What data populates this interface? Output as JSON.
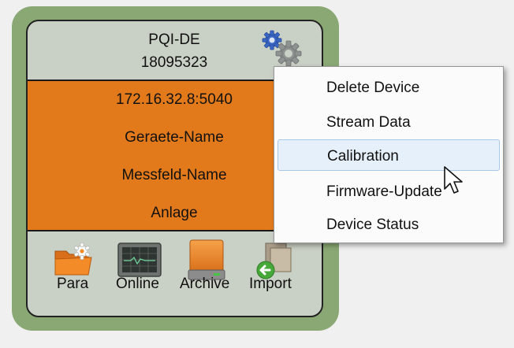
{
  "device": {
    "name": "PQI-DE",
    "serial": "18095323",
    "ip": "172.16.32.8:5040",
    "device_name": "Geraete-Name",
    "field_name": "Messfeld-Name",
    "plant": "Anlage"
  },
  "toolbar": {
    "para": "Para",
    "online": "Online",
    "archive": "Archive",
    "import": "Import"
  },
  "context_menu": {
    "items": [
      "Delete Device",
      "Stream Data",
      "Calibration",
      "Firmware-Update",
      "Device Status"
    ],
    "hovered": "Calibration"
  },
  "colors": {
    "outer_frame": "#8aa874",
    "card": "#c9d0c5",
    "info_panel": "#e27a1c",
    "menu_hover": "#e6f0fa"
  },
  "icons": [
    "settings-gear-icon",
    "para-folder-gear-icon",
    "online-monitor-icon",
    "archive-drive-icon",
    "import-icon",
    "mouse-pointer-icon"
  ]
}
